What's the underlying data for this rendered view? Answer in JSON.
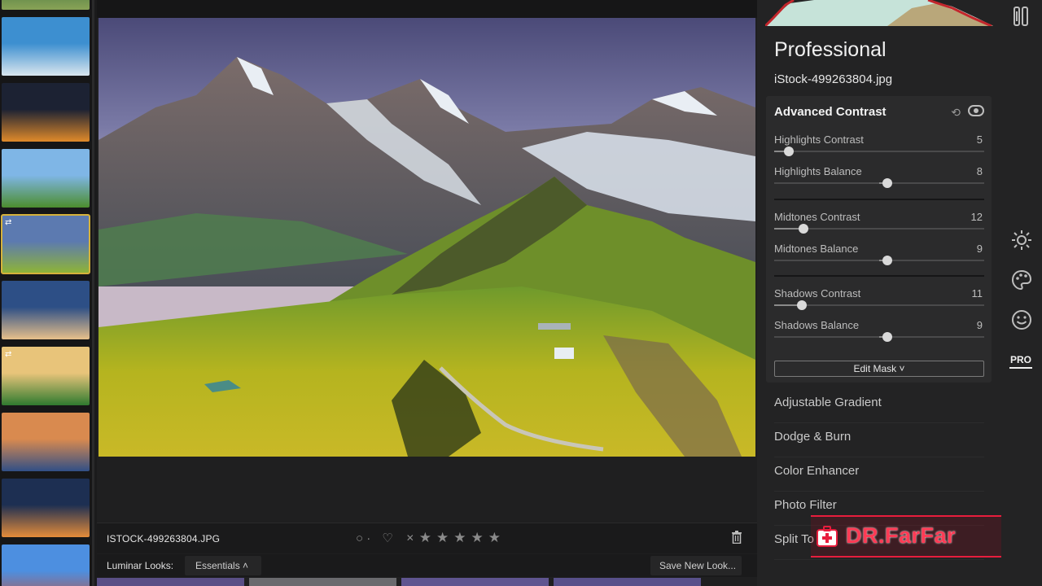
{
  "filmstrip": {
    "thumbs": [
      {
        "colors": [
          "#3b6f3e",
          "#89a356"
        ]
      },
      {
        "colors": [
          "#3d8fd0",
          "#d9e6ee"
        ]
      },
      {
        "colors": [
          "#1c2233",
          "#e08a2a"
        ]
      },
      {
        "colors": [
          "#7fb6e6",
          "#4c8d2e"
        ]
      },
      {
        "colors": [
          "#5c7ab0",
          "#8fb534"
        ],
        "selected": true,
        "sync_icon": "⇄"
      },
      {
        "colors": [
          "#2d4f86",
          "#e7c08a"
        ]
      },
      {
        "colors": [
          "#e8c47a",
          "#2f7a2f"
        ],
        "sync_icon": "⇄"
      },
      {
        "colors": [
          "#d98a4f",
          "#314f86"
        ]
      },
      {
        "colors": [
          "#1d2f52",
          "#e48c3a"
        ]
      },
      {
        "colors": [
          "#4d8fe0",
          "#b8564a"
        ]
      }
    ]
  },
  "photo": {
    "filename": "ISTOCK-499263804.JPG"
  },
  "rating": {
    "circle_label": "○ ·",
    "heart": "♡",
    "reject": "✕",
    "stars": [
      "★",
      "★",
      "★",
      "★",
      "★"
    ]
  },
  "looks": {
    "label": "Luminar Looks:",
    "selected": "Essentials  ˄",
    "save_label": "Save New Look..."
  },
  "panel": {
    "preset_title": "Professional",
    "image_name": "iStock-499263804.jpg",
    "active_filter": {
      "name": "Advanced Contrast",
      "sliders": [
        {
          "label": "Highlights Contrast",
          "value": 5,
          "position": 0.07
        },
        {
          "label": "Highlights Balance",
          "value": 8,
          "position": 0.54
        },
        {
          "label": "Midtones Contrast",
          "value": 12,
          "position": 0.14
        },
        {
          "label": "Midtones Balance",
          "value": 9,
          "position": 0.54
        },
        {
          "label": "Shadows Contrast",
          "value": 11,
          "position": 0.13
        },
        {
          "label": "Shadows Balance",
          "value": 9,
          "position": 0.54
        }
      ],
      "edit_mask_label": "Edit Mask ˅"
    },
    "filters": [
      "Adjustable Gradient",
      "Dodge & Burn",
      "Color Enhancer",
      "Photo Filter",
      "Split To"
    ]
  },
  "tools": {
    "pro_label": "PRO"
  },
  "watermark": {
    "text": "DR.FarFar"
  }
}
